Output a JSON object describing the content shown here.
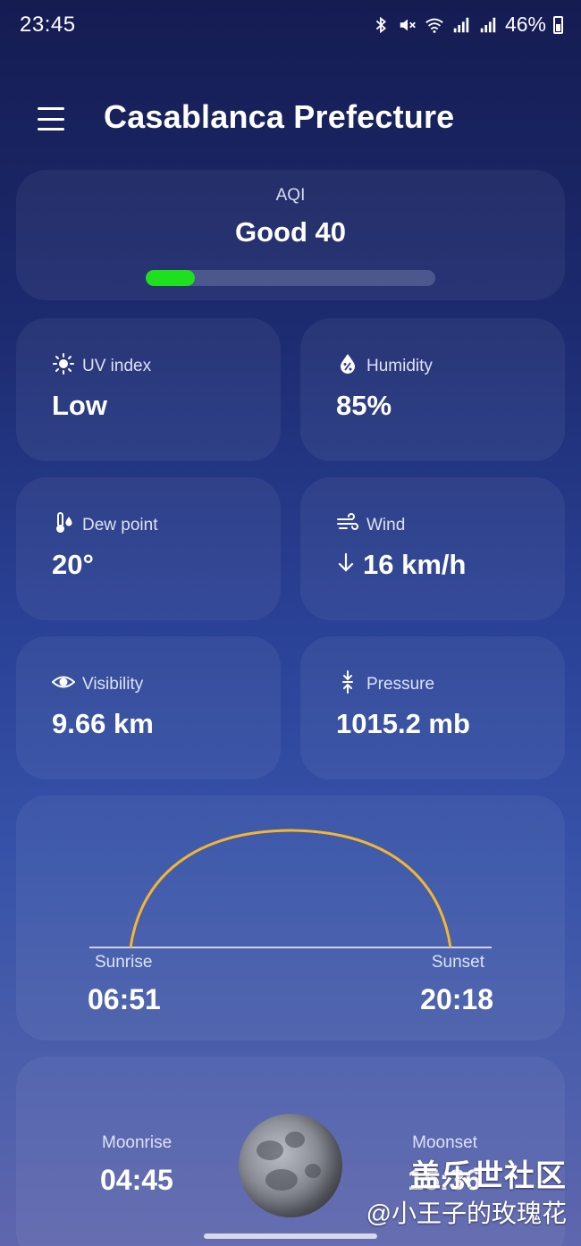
{
  "status_bar": {
    "time": "23:45",
    "battery": "46%",
    "icons": [
      "bluetooth-icon",
      "mute-icon",
      "wifi-icon",
      "signal-icon",
      "signal-icon",
      "battery-icon"
    ]
  },
  "header": {
    "title": "Casablanca Prefecture",
    "menu_icon": "hamburger-menu-icon"
  },
  "aqi": {
    "label": "AQI",
    "value": "Good 40",
    "level_fraction": 0.17,
    "bar_color": "#1ee01e"
  },
  "details": {
    "uv": {
      "label": "UV index",
      "value": "Low",
      "icon": "sun-icon"
    },
    "humidity": {
      "label": "Humidity",
      "value": "85%",
      "icon": "droplet-percent-icon"
    },
    "dew_point": {
      "label": "Dew point",
      "value": "20°",
      "icon": "thermometer-drop-icon"
    },
    "wind": {
      "label": "Wind",
      "value": "16 km/h",
      "icon": "wind-icon",
      "direction_icon": "arrow-down-icon"
    },
    "visibility": {
      "label": "Visibility",
      "value": "9.66 km",
      "icon": "eye-icon"
    },
    "pressure": {
      "label": "Pressure",
      "value": "1015.2 mb",
      "icon": "pressure-icon"
    }
  },
  "sun": {
    "sunrise_label": "Sunrise",
    "sunrise_time": "06:51",
    "sunset_label": "Sunset",
    "sunset_time": "20:18",
    "arc_color": "#f2b632"
  },
  "moon": {
    "moonrise_label": "Moonrise",
    "moonrise_time": "04:45",
    "moonset_label": "Moonset",
    "moonset_time": "15:36"
  },
  "watermark": {
    "line1": "盖乐世社区",
    "line2": "@小王子的玫瑰花"
  }
}
